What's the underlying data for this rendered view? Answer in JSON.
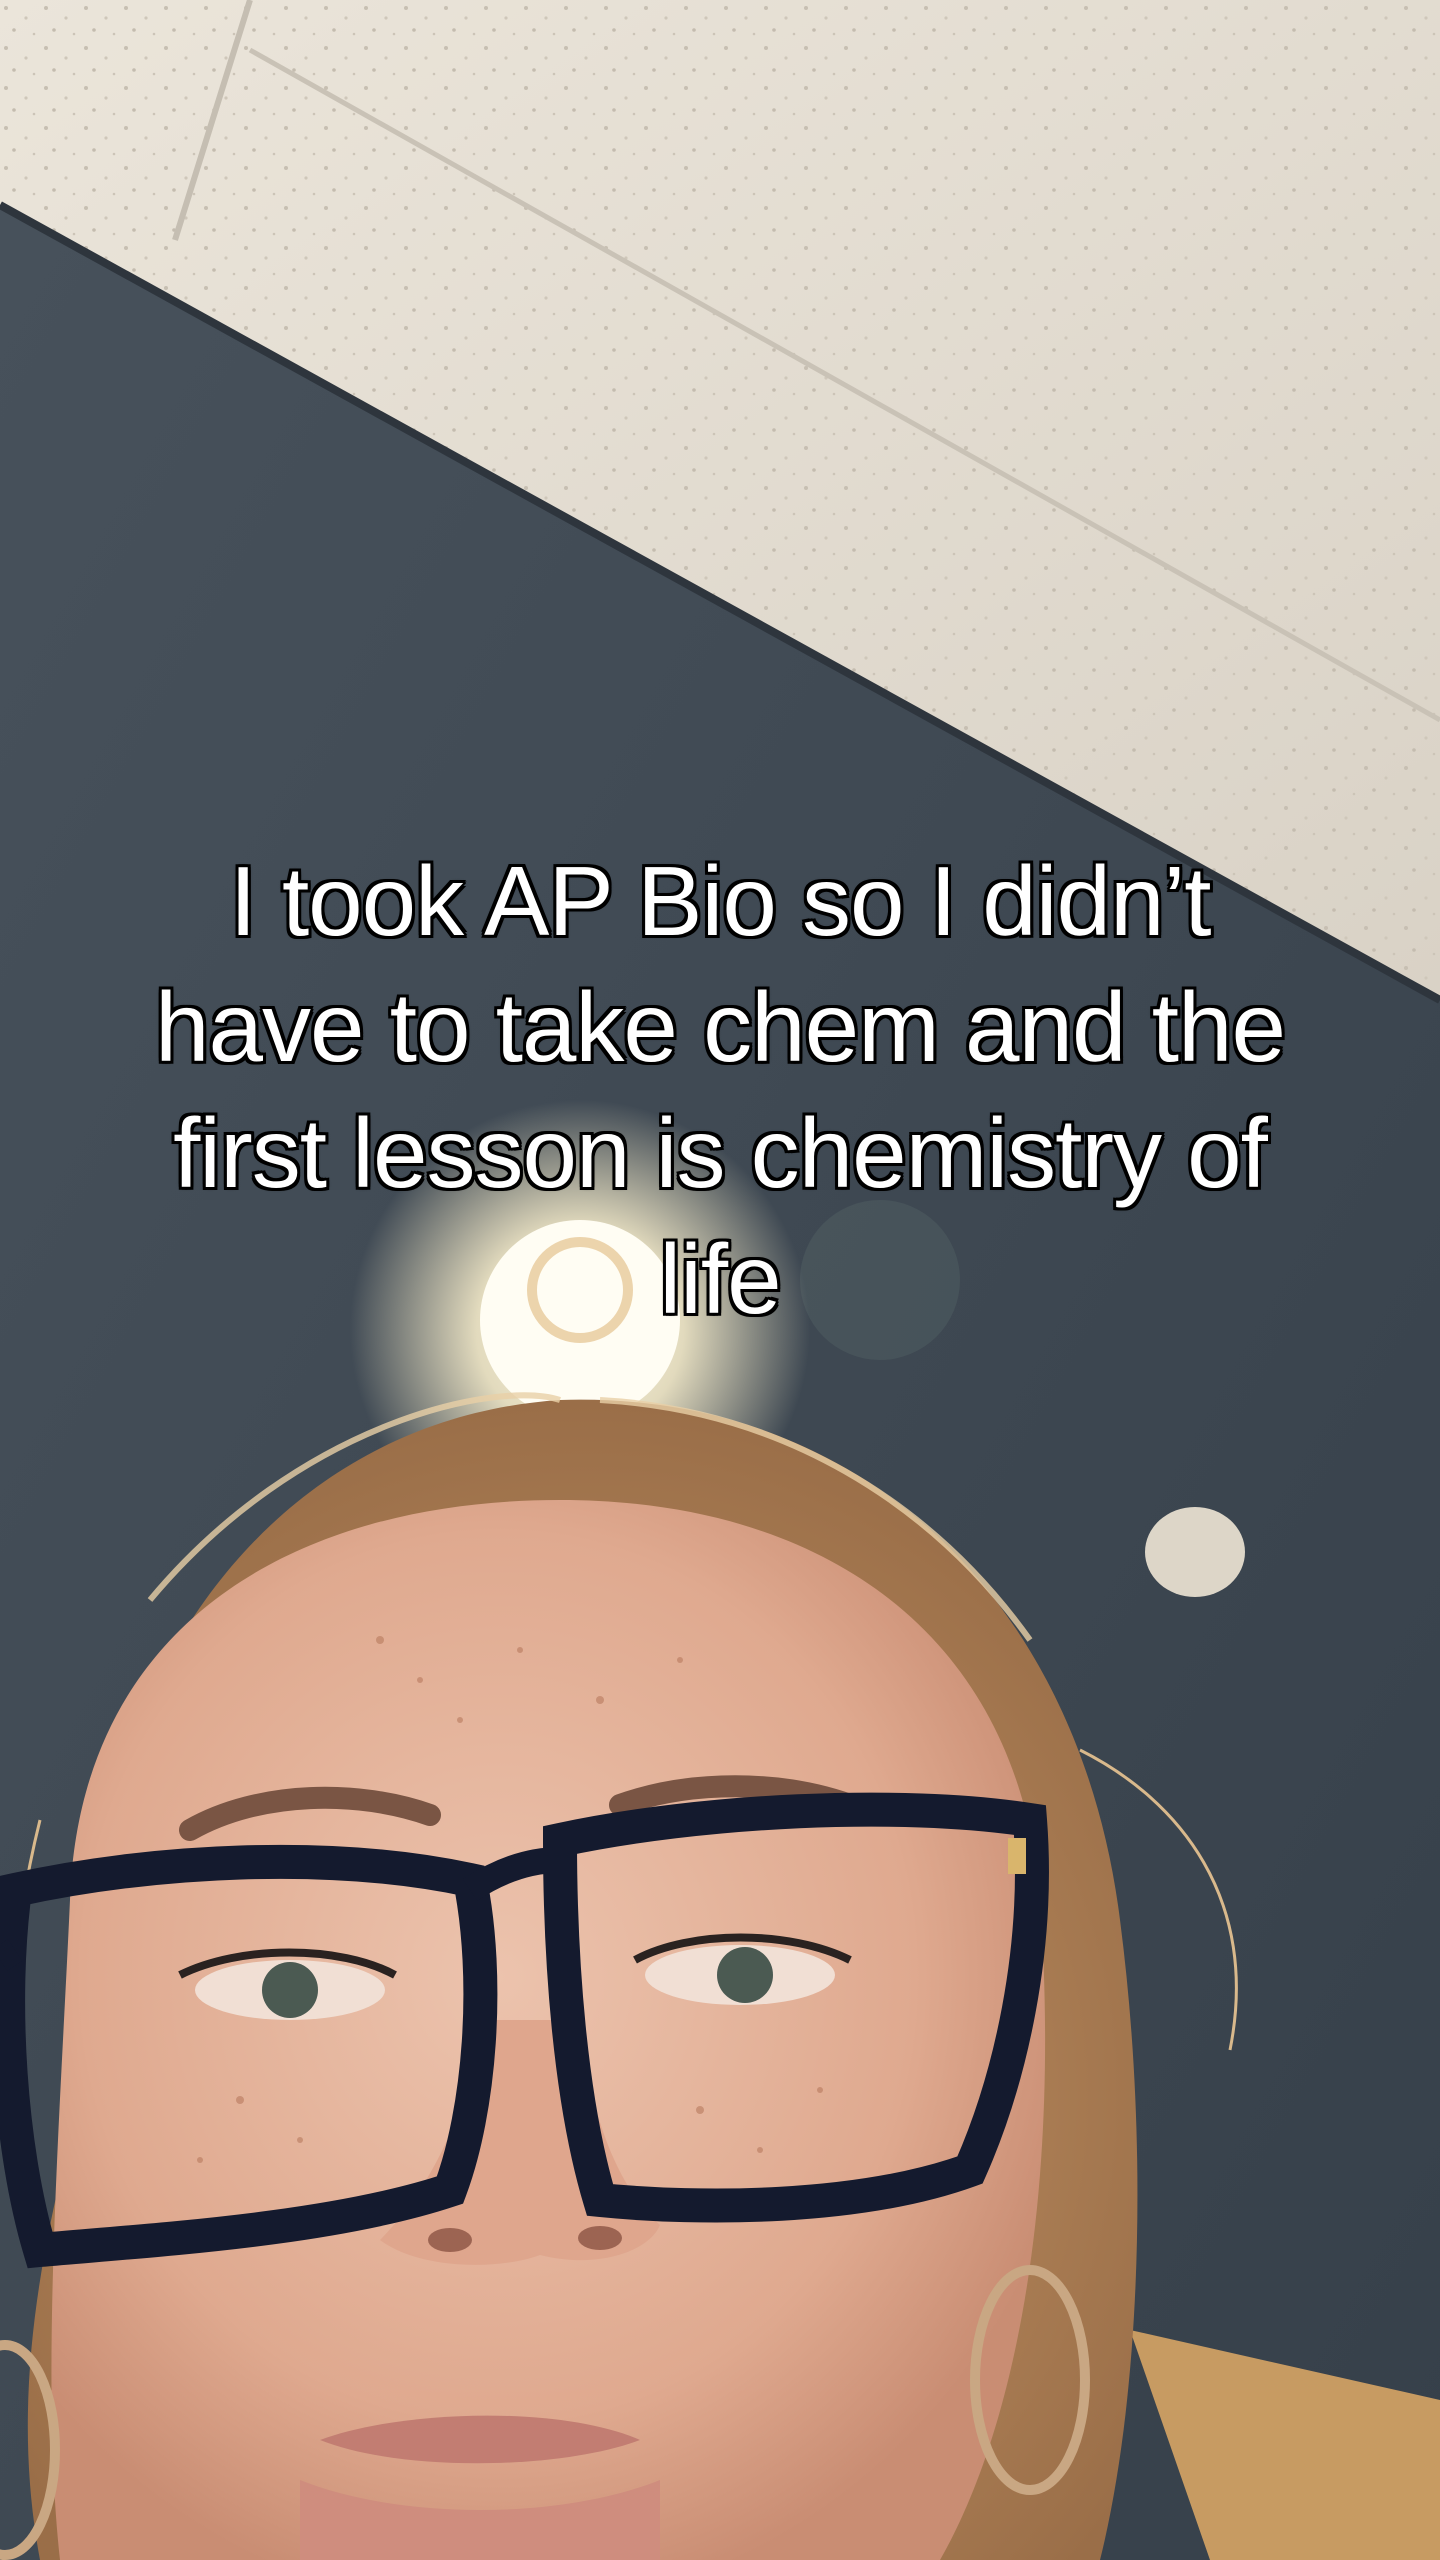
{
  "caption": {
    "lines": [
      "I took AP Bio so I didn’t",
      "have to take chem and the",
      "first lesson is chemistry of",
      "life"
    ]
  },
  "colors": {
    "ceiling": "#e3dcd1",
    "wall": "#3f4953",
    "skin": "#e6b6a0",
    "glasses_frame": "#141a2e",
    "caption_text": "#ffffff",
    "caption_outline": "#000000"
  }
}
